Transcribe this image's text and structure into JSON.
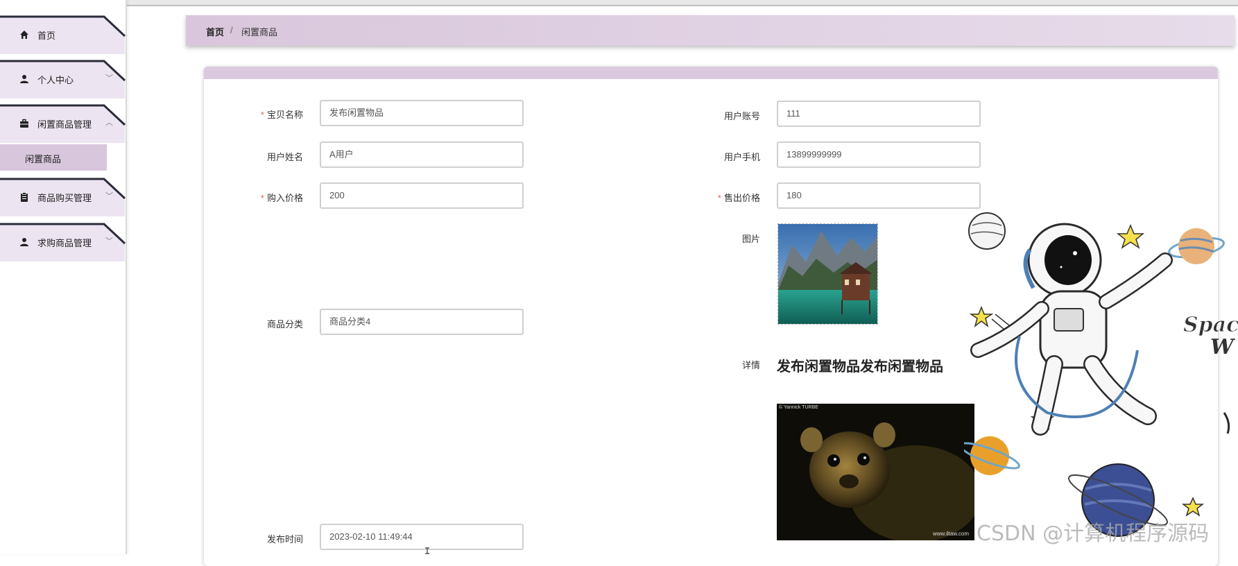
{
  "sidebar": {
    "items": [
      {
        "label": "首页",
        "icon": "home-icon",
        "chevron": ""
      },
      {
        "label": "个人中心",
        "icon": "user-icon",
        "chevron": "﹀"
      },
      {
        "label": "闲置商品管理",
        "icon": "briefcase-icon",
        "chevron": "︿"
      },
      {
        "label": "商品购买管理",
        "icon": "clipboard-icon",
        "chevron": "﹀"
      },
      {
        "label": "求购商品管理",
        "icon": "user-icon",
        "chevron": "﹀"
      }
    ],
    "submenu": {
      "label": "闲置商品"
    }
  },
  "breadcrumb": {
    "home": "首页",
    "separator": "/",
    "current": "闲置商品"
  },
  "form": {
    "left": {
      "name": {
        "label": "宝贝名称",
        "required": "*",
        "value": "发布闲置物品"
      },
      "username": {
        "label": "用户姓名",
        "value": "A用户"
      },
      "buy_price": {
        "label": "购入价格",
        "required": "*",
        "value": "200"
      },
      "category": {
        "label": "商品分类",
        "value": "商品分类4"
      },
      "publish_time": {
        "label": "发布时间",
        "value": "2023-02-10 11:49:44"
      }
    },
    "right": {
      "account": {
        "label": "用户账号",
        "value": "111"
      },
      "phone": {
        "label": "用户手机",
        "value": "13899999999"
      },
      "sell_price": {
        "label": "售出价格",
        "required": "*",
        "value": "180"
      },
      "image": {
        "label": "图片"
      },
      "detail": {
        "label": "详情",
        "title": "发布闲置物品发布闲置物品",
        "photo_credit": "© Yannick TURBE",
        "photo_site": "www.iltaw.com"
      }
    }
  },
  "decoration": {
    "text1": "Space",
    "text2": "W"
  },
  "watermark": "CSDN @计算机程序源码",
  "colors": {
    "accent": "#d9c6dc",
    "menu": "#ede4f1",
    "required": "#e25c5c"
  }
}
